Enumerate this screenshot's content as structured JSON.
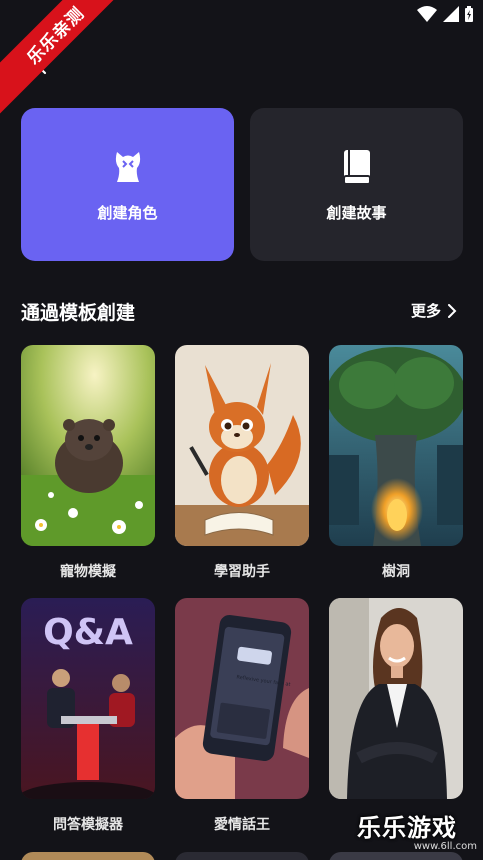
{
  "ribbon": {
    "text": "乐乐亲测"
  },
  "status_bar": {
    "icons": [
      "wifi-icon",
      "signal-icon",
      "battery-icon"
    ]
  },
  "close": {
    "icon": "close-icon"
  },
  "actions": [
    {
      "label": "創建角色",
      "icon": "character-icon",
      "color": "#6a63f2"
    },
    {
      "label": "創建故事",
      "icon": "book-icon",
      "color": "#25252c"
    }
  ],
  "templates": {
    "title": "通過模板創建",
    "more": "更多",
    "items": [
      {
        "label": "寵物模擬"
      },
      {
        "label": "學習助手"
      },
      {
        "label": "樹洞"
      },
      {
        "label": "問答模擬器",
        "image_text": "Q&A"
      },
      {
        "label": "愛情話王",
        "image_text": "Reflexive your face at"
      },
      {
        "label": ""
      }
    ]
  },
  "watermark": {
    "title": "乐乐游戏",
    "url": "www.6ll.com"
  }
}
